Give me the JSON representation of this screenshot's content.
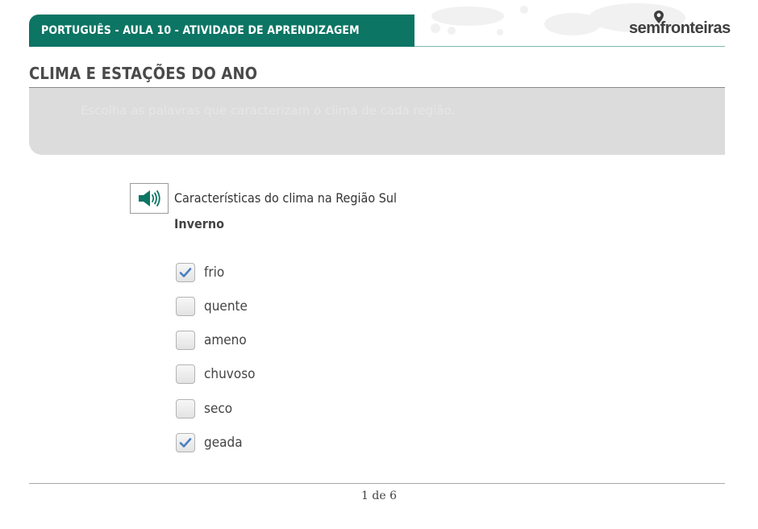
{
  "header": {
    "lesson_title": "PORTUGUÊS - AULA 10 - ATIVIDADE DE APRENDIZAGEM",
    "logo_text": "semfronteiras",
    "brand_color": "#0c7564"
  },
  "page_title": "CLIMA E ESTAÇÕES DO ANO",
  "instruction": {
    "text": "Escolha as palavras que caracterizam o clima de cada região."
  },
  "question": {
    "audio_icon": "speaker-icon",
    "label": "Características do clima na Região Sul",
    "season": "Inverno"
  },
  "options": [
    {
      "label": "frio",
      "checked": true
    },
    {
      "label": "quente",
      "checked": false
    },
    {
      "label": "ameno",
      "checked": false
    },
    {
      "label": "chuvoso",
      "checked": false
    },
    {
      "label": "seco",
      "checked": false
    },
    {
      "label": "geada",
      "checked": true
    }
  ],
  "footer": {
    "page_counter": "1 de 6"
  },
  "colors": {
    "checkmark": "#4a7fc1",
    "title_text": "#4a4a4a"
  }
}
